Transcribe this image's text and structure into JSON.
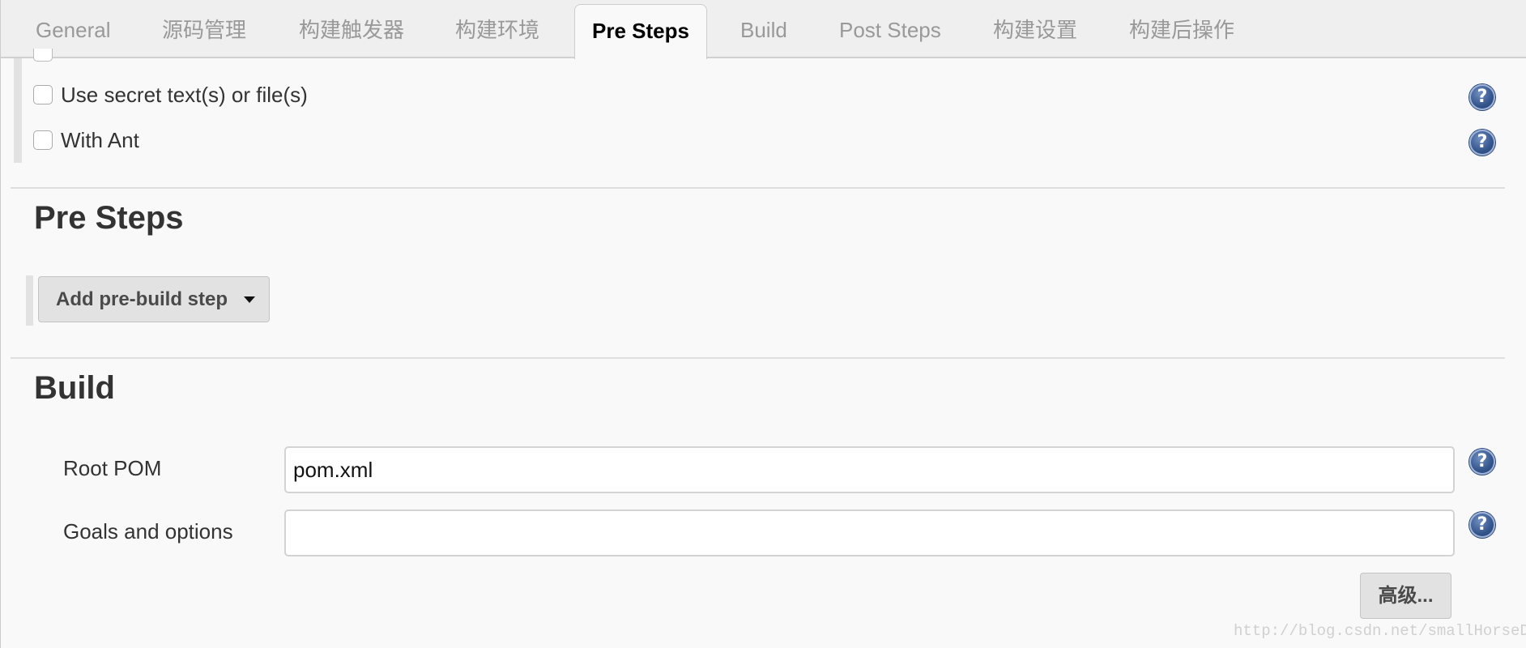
{
  "tabs": [
    {
      "label": "General",
      "active": false
    },
    {
      "label": "源码管理",
      "active": false
    },
    {
      "label": "构建触发器",
      "active": false
    },
    {
      "label": "构建环境",
      "active": false
    },
    {
      "label": "Pre Steps",
      "active": true
    },
    {
      "label": "Build",
      "active": false
    },
    {
      "label": "Post Steps",
      "active": false
    },
    {
      "label": "构建设置",
      "active": false
    },
    {
      "label": "构建后操作",
      "active": false
    }
  ],
  "build_environment": {
    "options": [
      {
        "label": "Use secret text(s) or file(s)",
        "checked": false,
        "help_icon": "help-icon"
      },
      {
        "label": "With Ant",
        "checked": false,
        "help_icon": "help-icon"
      }
    ]
  },
  "pre_steps": {
    "title": "Pre Steps",
    "add_button_label": "Add pre-build step",
    "add_button_icon": "caret-down-icon"
  },
  "build": {
    "title": "Build",
    "fields": [
      {
        "label": "Root POM",
        "value": "pom.xml",
        "placeholder": ""
      },
      {
        "label": "Goals and options",
        "value": "",
        "placeholder": ""
      }
    ],
    "advanced_button_label": "高级..."
  },
  "watermark": "http://blog.csdn.net/smallHorseDaDa"
}
